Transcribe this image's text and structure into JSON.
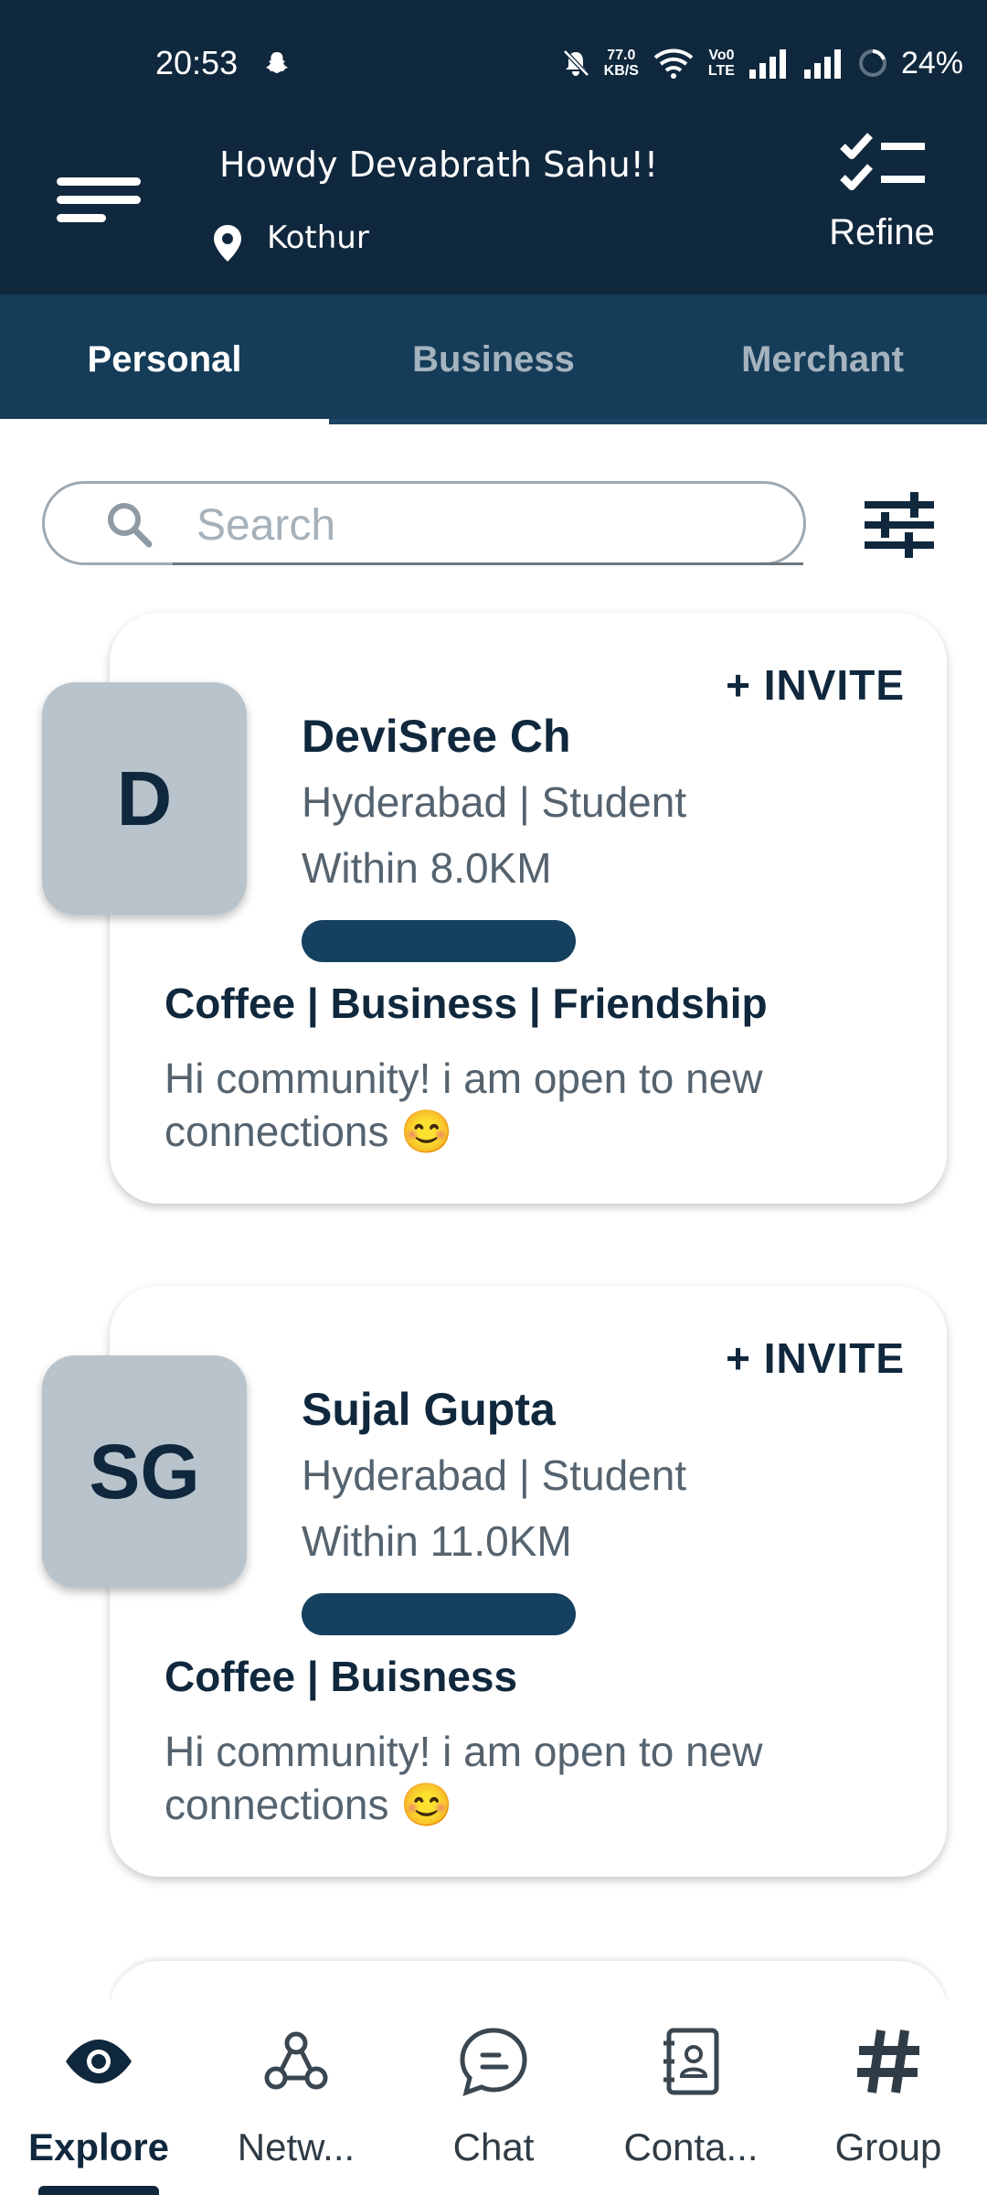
{
  "status": {
    "time": "20:53",
    "speed_top": "77.0",
    "speed_unit": "KB/S",
    "volte_top": "Vo0",
    "volte_bottom": "LTE",
    "battery": "24%"
  },
  "header": {
    "greeting": "Howdy Devabrath Sahu!!",
    "location": "Kothur",
    "refine_label": "Refine"
  },
  "tabs": [
    {
      "label": "Personal"
    },
    {
      "label": "Business"
    },
    {
      "label": "Merchant"
    }
  ],
  "search": {
    "placeholder": "Search",
    "value": ""
  },
  "cards": [
    {
      "initials": "D",
      "invite_label": "+ INVITE",
      "name": "DeviSree Ch",
      "subtitle": "Hyderabad | Student",
      "distance": "Within 8.0KM",
      "interests": "Coffee | Business | Friendship",
      "bio": "Hi community! i am open to new connections 😊"
    },
    {
      "initials": "SG",
      "invite_label": "+ INVITE",
      "name": "Sujal Gupta",
      "subtitle": "Hyderabad | Student",
      "distance": "Within 11.0KM",
      "interests": "Coffee | Buisness",
      "bio": "Hi community! i am open to new connections 😊"
    }
  ],
  "nav": [
    {
      "label": "Explore",
      "icon": "eye-icon"
    },
    {
      "label": "Netw...",
      "icon": "network-icon"
    },
    {
      "label": "Chat",
      "icon": "chat-icon"
    },
    {
      "label": "Conta...",
      "icon": "contacts-icon"
    },
    {
      "label": "Group",
      "icon": "hashtag-icon"
    }
  ],
  "colors": {
    "primary": "#10283d",
    "tab_bar": "#153c58",
    "avatar_bg": "#b8c3cb",
    "progress": "#16405f"
  }
}
